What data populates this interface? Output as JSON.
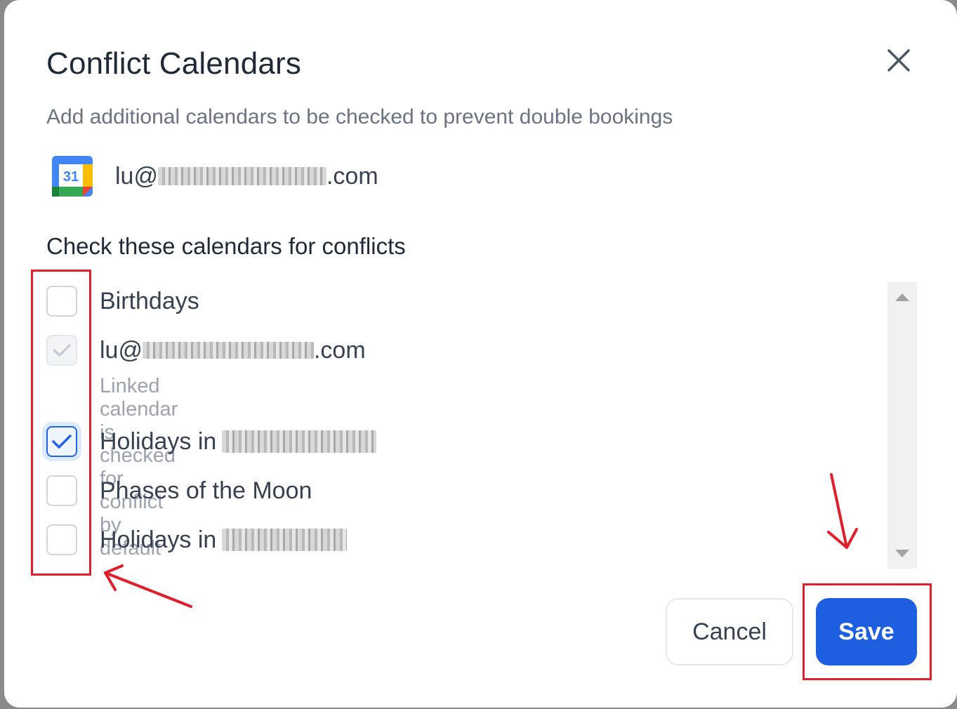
{
  "dialog": {
    "title": "Conflict Calendars",
    "subtitle": "Add additional calendars to be checked to prevent double bookings",
    "close_icon": "close-icon"
  },
  "account": {
    "icon": "google-calendar-icon",
    "icon_day": "31",
    "email_prefix": "lu@",
    "email_suffix": ".com"
  },
  "calendars_section": {
    "label": "Check these calendars for conflicts",
    "items": [
      {
        "label": "Birthdays",
        "checked": false,
        "disabled": false
      },
      {
        "label_prefix": "lu@",
        "label_suffix": ".com",
        "checked": true,
        "disabled": true,
        "hint": "Linked calendar is checked for conflict by default"
      },
      {
        "label": "Holidays in",
        "checked": true,
        "disabled": false
      },
      {
        "label": "Phases of the Moon",
        "checked": false,
        "disabled": false
      },
      {
        "label": "Holidays in",
        "checked": false,
        "disabled": false
      }
    ]
  },
  "actions": {
    "cancel_label": "Cancel",
    "save_label": "Save"
  },
  "colors": {
    "accent": "#1d5fe0",
    "annotation": "#e01f2d"
  }
}
